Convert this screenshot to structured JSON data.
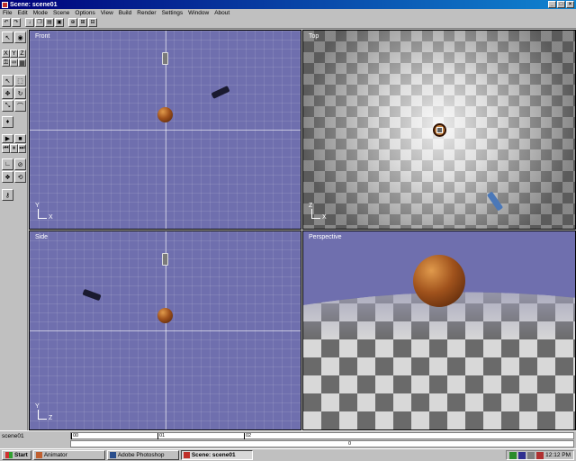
{
  "window": {
    "title": "Scene: scene01"
  },
  "titlebar_buttons": [
    "_",
    "□",
    "×"
  ],
  "menu": [
    "File",
    "Edit",
    "Mode",
    "Scene",
    "Options",
    "View",
    "Build",
    "Render",
    "Settings",
    "Window",
    "About"
  ],
  "palette": {
    "axis_x": "X",
    "axis_y": "Y",
    "axis_z": "Z"
  },
  "viewports": {
    "front": {
      "label": "Front",
      "axis_up": "Y",
      "axis_right": "X"
    },
    "top": {
      "label": "Top",
      "axis_up": "Z",
      "axis_right": "X"
    },
    "side": {
      "label": "Side",
      "axis_up": "Y",
      "axis_right": "Z"
    },
    "perspective": {
      "label": "Perspective"
    }
  },
  "timeline": {
    "scene_name": "scene01",
    "ticks": [
      "00",
      "01",
      "02"
    ],
    "current_frame": "0"
  },
  "taskbar": {
    "start": "Start",
    "tasks": [
      {
        "label": "Animator"
      },
      {
        "label": "Adobe Photoshop"
      },
      {
        "label": "Scene: scene01"
      }
    ],
    "clock": "12:12 PM"
  },
  "colors": {
    "viewport_bg": "#6f6fae",
    "title_bar": "#00007a",
    "sphere": "#a0521c"
  }
}
